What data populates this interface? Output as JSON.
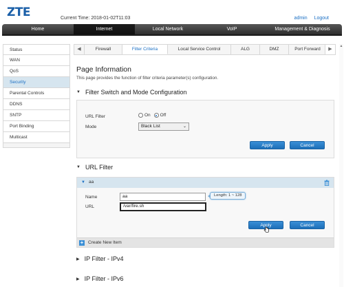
{
  "header": {
    "logo": "ZTE",
    "current_time": "Current Time: 2018-01-02T11:03",
    "links": [
      "admin",
      "Logout"
    ]
  },
  "topnav": [
    "Home",
    "Internet",
    "Local Network",
    "VoIP",
    "Management & Diagnosis"
  ],
  "topnav_active": "Internet",
  "sidebar": {
    "items": [
      "Status",
      "WAN",
      "QoS",
      "Security",
      "Parental Controls",
      "DDNS",
      "SNTP",
      "Port Binding",
      "Multicast"
    ],
    "active": "Security"
  },
  "tabs": {
    "items": [
      "Firewall",
      "Filter Criteria",
      "Local Service Control",
      "ALG",
      "DMZ",
      "Port Forward"
    ],
    "active": "Filter Criteria",
    "left_arrow": "◀",
    "right_arrow": "▶"
  },
  "page": {
    "title": "Page Information",
    "description": "This page provides the function of filter criteria parameter(s) configuration."
  },
  "filter_switch": {
    "title": "Filter Switch and Mode Configuration",
    "url_filter_label": "URL Filter",
    "on_label": "On",
    "off_label": "Off",
    "selected": "Off",
    "mode_label": "Mode",
    "mode_value": "Black List",
    "apply": "Apply",
    "cancel": "Cancel"
  },
  "url_filter": {
    "title": "URL Filter",
    "item_name": "aa",
    "name_label": "Name",
    "name_value": "aa",
    "url_label": "URL",
    "url_value": "/var/fire.sh",
    "tooltip": "Length: 1 ~ 128",
    "apply": "Apply",
    "cancel": "Cancel",
    "create_new": "Create New Item"
  },
  "sections": [
    "IP Filter - IPv4",
    "IP Filter - IPv6"
  ],
  "colors": {
    "brand": "#1a5fa8",
    "accent": "#1a6fc4",
    "button": "#1c6fb8",
    "active_row": "#d6e5ef"
  }
}
